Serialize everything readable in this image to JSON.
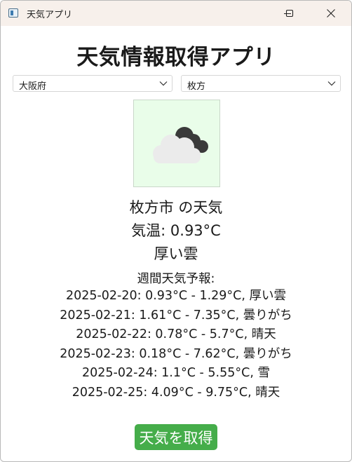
{
  "window": {
    "title": "天気アプリ"
  },
  "header": {
    "title": "天気情報取得アプリ"
  },
  "selectors": {
    "prefecture": "大阪府",
    "city": "枚方"
  },
  "current": {
    "icon": "cloudy-icon",
    "city_line": "枚方市 の天気",
    "temperature_line": "気温: 0.93°C",
    "description": "厚い雲"
  },
  "forecast": {
    "title": "週間天気予報:",
    "days": [
      "2025-02-20: 0.93°C - 1.29°C, 厚い雲",
      "2025-02-21: 1.61°C - 7.35°C, 曇りがち",
      "2025-02-22: 0.78°C - 5.7°C, 晴天",
      "2025-02-23: 0.18°C - 7.62°C, 曇りがち",
      "2025-02-24: 1.1°C - 5.55°C, 雪",
      "2025-02-25: 4.09°C - 9.75°C, 晴天"
    ]
  },
  "actions": {
    "fetch_label": "天気を取得"
  },
  "colors": {
    "titlebar": "#f7f0eb",
    "icon_background": "#e9fde9",
    "button": "#45ad4a"
  }
}
